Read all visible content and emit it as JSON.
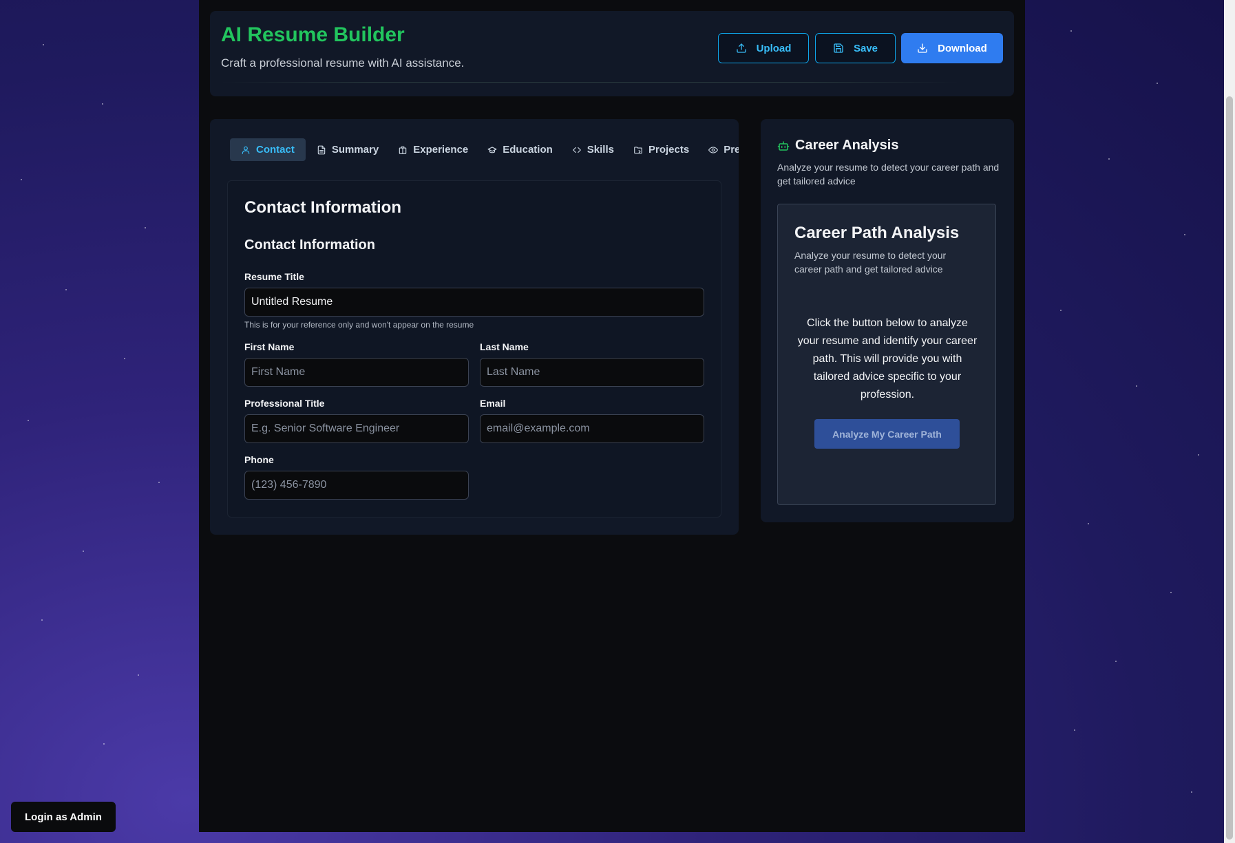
{
  "header": {
    "title": "AI Resume Builder",
    "subtitle": "Craft a professional resume with AI assistance.",
    "buttons": {
      "upload": "Upload",
      "save": "Save",
      "download": "Download"
    }
  },
  "tabs": [
    {
      "label": "Contact",
      "icon": "user-icon",
      "active": true
    },
    {
      "label": "Summary",
      "icon": "document-icon",
      "active": false
    },
    {
      "label": "Experience",
      "icon": "building-icon",
      "active": false
    },
    {
      "label": "Education",
      "icon": "graduation-cap-icon",
      "active": false
    },
    {
      "label": "Skills",
      "icon": "code-icon",
      "active": false
    },
    {
      "label": "Projects",
      "icon": "folder-icon",
      "active": false
    },
    {
      "label": "Preview",
      "icon": "eye-icon",
      "active": false
    }
  ],
  "form": {
    "heading": "Contact Information",
    "subheading": "Contact Information",
    "resume_title": {
      "label": "Resume Title",
      "value": "Untitled Resume",
      "hint": "This is for your reference only and won't appear on the resume"
    },
    "first_name": {
      "label": "First Name",
      "placeholder": "First Name"
    },
    "last_name": {
      "label": "Last Name",
      "placeholder": "Last Name"
    },
    "professional_title": {
      "label": "Professional Title",
      "placeholder": "E.g. Senior Software Engineer"
    },
    "email": {
      "label": "Email",
      "placeholder": "email@example.com"
    },
    "phone": {
      "label": "Phone",
      "placeholder": "(123) 456-7890"
    }
  },
  "career": {
    "title": "Career Analysis",
    "icon": "robot-icon",
    "subtitle": "Analyze your resume to detect your career path and get tailored advice",
    "panel_title": "Career Path Analysis",
    "panel_subtitle": "Analyze your resume to detect your career path and get tailored advice",
    "body": "Click the button below to analyze your resume and identify your career path. This will provide you with tailored advice specific to your profession.",
    "button": "Analyze My Career Path"
  },
  "admin_button": "Login as Admin",
  "colors": {
    "accent_green": "#22c55e",
    "accent_cyan": "#38bdf8",
    "primary_blue": "#2f7cf0",
    "card_bg": "#111827"
  }
}
